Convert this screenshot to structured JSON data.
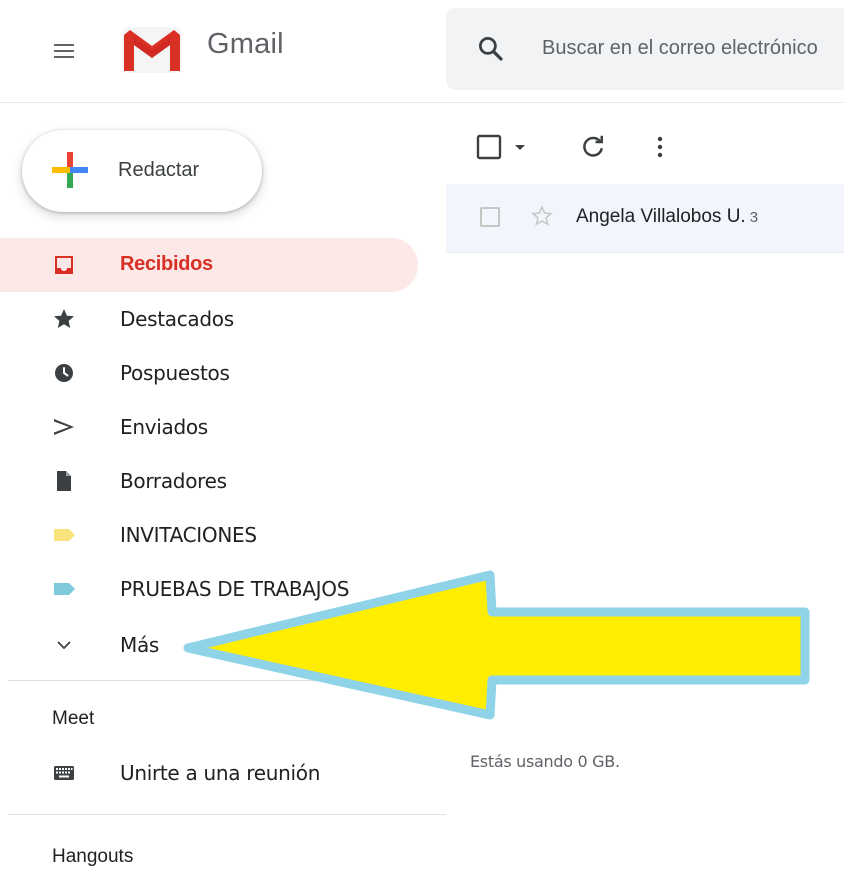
{
  "header": {
    "app_name": "Gmail",
    "menu_icon": "hamburger-menu-icon",
    "logo_icon": "gmail-logo-icon",
    "search": {
      "placeholder": "Buscar en el correo electrónico",
      "icon": "search-icon"
    }
  },
  "compose": {
    "label": "Redactar",
    "icon": "compose-plus-icon"
  },
  "nav": {
    "items": [
      {
        "label": "Recibidos",
        "icon": "inbox-icon",
        "active": true
      },
      {
        "label": "Destacados",
        "icon": "star-icon"
      },
      {
        "label": "Pospuestos",
        "icon": "clock-icon"
      },
      {
        "label": "Enviados",
        "icon": "send-icon"
      },
      {
        "label": "Borradores",
        "icon": "draft-icon"
      },
      {
        "label": "INVITACIONES",
        "icon": "label-icon",
        "color": "#f8e27c"
      },
      {
        "label": "PRUEBAS DE TRABAJOS",
        "icon": "label-icon",
        "color": "#7ec9dc"
      },
      {
        "label": "Más",
        "icon": "chevron-down-icon"
      }
    ]
  },
  "meet": {
    "title": "Meet",
    "join_label": "Unirte a una reunión",
    "join_icon": "keyboard-icon"
  },
  "hangouts": {
    "title": "Hangouts"
  },
  "mail_list": {
    "toolbar": {
      "select_icon": "checkbox-icon",
      "dropdown_icon": "caret-down-icon",
      "refresh_icon": "refresh-icon",
      "more_icon": "more-vert-icon"
    },
    "rows": [
      {
        "sender": "Angela Villalobos U.",
        "count": "3"
      }
    ],
    "storage": "Estás usando 0 GB."
  },
  "annotation": {
    "arrow_fill": "#ffee00",
    "arrow_stroke": "#8fd3e8"
  },
  "colors": {
    "accent_red": "#d93025",
    "active_bg": "#fce8e6"
  }
}
